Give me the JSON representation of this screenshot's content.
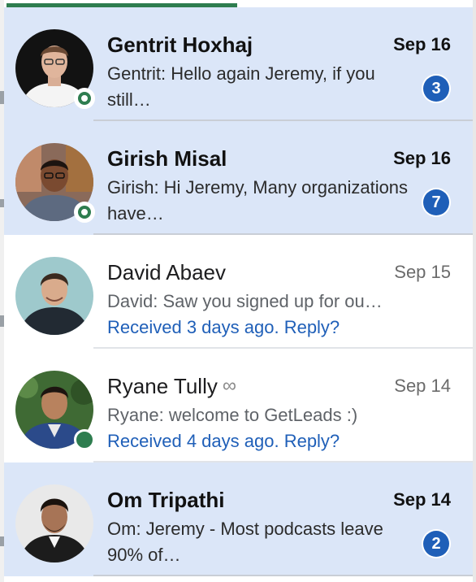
{
  "conversations": [
    {
      "name": "Gentrit Hoxhaj",
      "date": "Sep 16",
      "preview": "Gentrit: Hello again Jeremy, if you still…",
      "unread_count": "3",
      "status": "unread",
      "presence": "ring"
    },
    {
      "name": "Girish Misal",
      "date": "Sep 16",
      "preview": "Girish: Hi Jeremy, Many organizations have…",
      "unread_count": "7",
      "status": "unread",
      "presence": "ring"
    },
    {
      "name": "David Abaev",
      "date": "Sep 15",
      "preview": "David: Saw you signed up for ou…",
      "followup": "Received 3 days ago. Reply?",
      "status": "read",
      "presence": "none"
    },
    {
      "name": "Ryane Tully",
      "name_suffix_icon": "infinity-icon",
      "name_suffix_glyph": "∞",
      "date": "Sep 14",
      "preview": "Ryane: welcome to GetLeads :)",
      "followup": "Received 4 days ago. Reply?",
      "status": "read",
      "presence": "solid"
    },
    {
      "name": "Om Tripathi",
      "date": "Sep 14",
      "preview": "Om: Jeremy - Most podcasts leave 90% of…",
      "unread_count": "2",
      "status": "unread",
      "presence": "none"
    }
  ],
  "colors": {
    "unread_background": "#dbe6f8",
    "accent_blue": "#1f5fb8",
    "presence_green": "#2e7d4f",
    "tab_indicator_green": "#2e7d4f"
  }
}
